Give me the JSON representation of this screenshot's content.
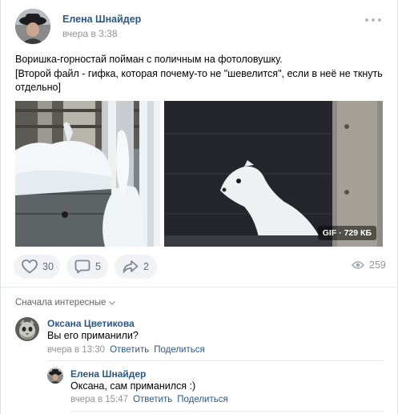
{
  "post": {
    "author": "Елена Шнайдер",
    "time": "вчера в 3:38",
    "text_line1": "Воришка-горностай пойман с поличным на фотоловушку.",
    "text_line2": "[Второй файл - гифка, которая почему-то не \"шевелится\", если в неё не ткнуть отдельно]",
    "photo1_icon": "photo-snow-fence",
    "photo2_icon": "photo-ermine",
    "gif_badge": "GIF · 729 КБ",
    "likes": "30",
    "comments": "5",
    "shares": "2",
    "views": "259"
  },
  "comments_section": {
    "sort_label": "Сначала интересные"
  },
  "comments": [
    {
      "author": "Оксана Цветикова",
      "text": "Вы его приманили?",
      "time": "вчера в 13:30",
      "reply": "Ответить",
      "share": "Поделиться"
    },
    {
      "author": "Елена Шнайдер",
      "text": "Оксана, сам приманился :)",
      "time": "вчера в 15:47",
      "reply": "Ответить",
      "share": "Поделиться"
    }
  ],
  "colors": {
    "link": "#2a5885",
    "muted": "#939393",
    "button_bg": "#f0f2f5"
  }
}
